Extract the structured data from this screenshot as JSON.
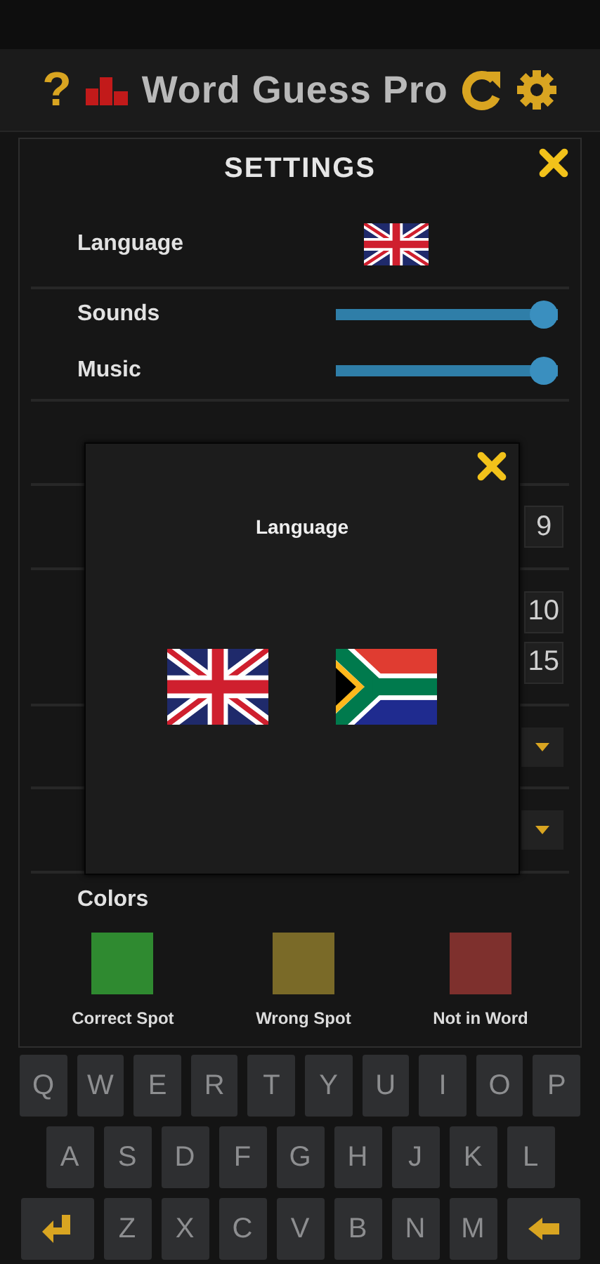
{
  "header": {
    "help": "?",
    "title": "Word Guess Pro"
  },
  "settings": {
    "title": "SETTINGS",
    "language": {
      "label": "Language",
      "kind": "uk"
    },
    "sliders": [
      {
        "label": "Sounds",
        "level": 1
      },
      {
        "label": "Music",
        "level": 1
      }
    ],
    "hidden_rows": [
      {
        "kind": "number",
        "values": [
          "9"
        ]
      },
      {
        "kind": "number",
        "values": [
          "10",
          "15"
        ]
      },
      {
        "kind": "dropdown"
      },
      {
        "kind": "dropdown"
      }
    ],
    "colors": {
      "label": "Colors",
      "swatches": [
        {
          "label": "Correct Spot",
          "color": "#2f8a30"
        },
        {
          "label": "Wrong Spot",
          "color": "#7a6a28"
        },
        {
          "label": "Not in Word",
          "color": "#7e302d"
        }
      ]
    }
  },
  "language_dialog": {
    "title": "Language",
    "options": [
      {
        "kind": "uk"
      },
      {
        "kind": "za"
      }
    ]
  },
  "keyboard": {
    "rows": [
      [
        {
          "kind": "letter",
          "label": "Q"
        },
        {
          "kind": "letter",
          "label": "W"
        },
        {
          "kind": "letter",
          "label": "E"
        },
        {
          "kind": "letter",
          "label": "R"
        },
        {
          "kind": "letter",
          "label": "T"
        },
        {
          "kind": "letter",
          "label": "Y"
        },
        {
          "kind": "letter",
          "label": "U"
        },
        {
          "kind": "letter",
          "label": "I"
        },
        {
          "kind": "letter",
          "label": "O"
        },
        {
          "kind": "letter",
          "label": "P"
        }
      ],
      [
        {
          "kind": "letter",
          "label": "A"
        },
        {
          "kind": "letter",
          "label": "S"
        },
        {
          "kind": "letter",
          "label": "D"
        },
        {
          "kind": "letter",
          "label": "F"
        },
        {
          "kind": "letter",
          "label": "G"
        },
        {
          "kind": "letter",
          "label": "H"
        },
        {
          "kind": "letter",
          "label": "J"
        },
        {
          "kind": "letter",
          "label": "K"
        },
        {
          "kind": "letter",
          "label": "L"
        }
      ],
      [
        {
          "kind": "enter"
        },
        {
          "kind": "letter",
          "label": "Z"
        },
        {
          "kind": "letter",
          "label": "X"
        },
        {
          "kind": "letter",
          "label": "C"
        },
        {
          "kind": "letter",
          "label": "V"
        },
        {
          "kind": "letter",
          "label": "B"
        },
        {
          "kind": "letter",
          "label": "N"
        },
        {
          "kind": "letter",
          "label": "M"
        },
        {
          "kind": "backspace"
        }
      ]
    ]
  }
}
